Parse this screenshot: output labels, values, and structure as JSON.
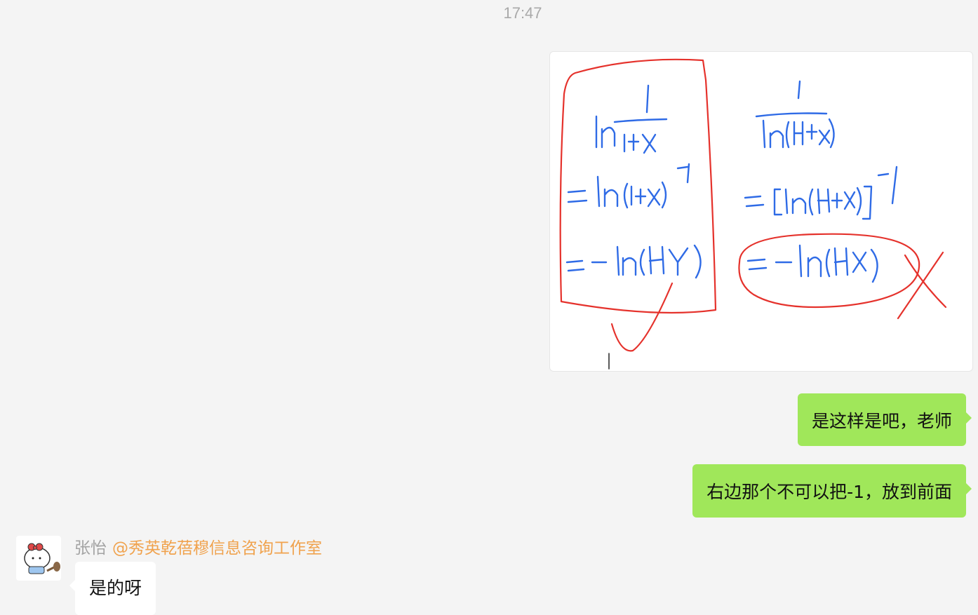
{
  "chat": {
    "timestamp": "17:47",
    "image_message": {
      "description_icon": "handwritten-math-image",
      "colors": {
        "ink_blue": "#2f6be6",
        "ink_red": "#e5322c"
      }
    },
    "outgoing": [
      {
        "text": "是这样是吧，老师"
      },
      {
        "text": "右边那个不可以把-1，放到前面"
      }
    ],
    "incoming": {
      "sender": "张怡",
      "mention": "@秀英乾蓓穆信息咨询工作室",
      "text": "是的呀"
    },
    "colors": {
      "background": "#f4f4f4",
      "outgoing_bubble": "#a0e75a",
      "incoming_bubble": "#ffffff",
      "mention": "#f0a24d"
    }
  }
}
